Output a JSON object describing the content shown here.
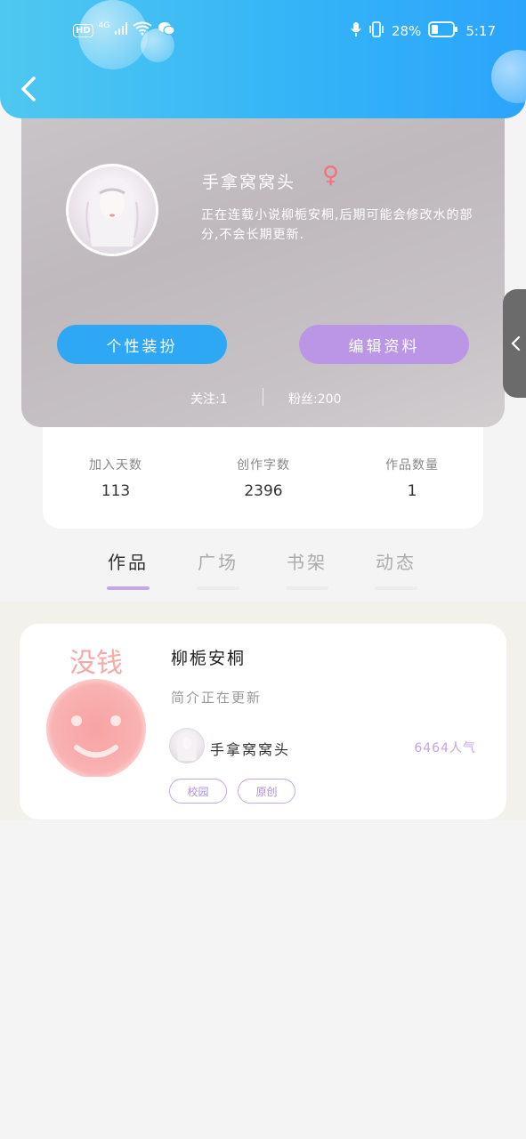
{
  "status_bar": {
    "left_badges": [
      "HD",
      "4G"
    ],
    "battery": "28%",
    "time": "5:17"
  },
  "profile": {
    "username": "手拿窝窝头",
    "gender_symbol": "♀",
    "bio": "正在连载小说柳栀安桐,后期可能会修改水的部分,不会长期更新.",
    "dress_button": "个性装扮",
    "edit_button": "编辑资料",
    "following": "关注:1",
    "followers": "粉丝:200"
  },
  "stats": [
    {
      "label": "加入天数",
      "value": "113"
    },
    {
      "label": "创作字数",
      "value": "2396"
    },
    {
      "label": "作品数量",
      "value": "1"
    }
  ],
  "tabs": [
    {
      "label": "作品",
      "active": true
    },
    {
      "label": "广场",
      "active": false
    },
    {
      "label": "书架",
      "active": false
    },
    {
      "label": "动态",
      "active": false
    }
  ],
  "works": [
    {
      "title": "柳栀安桐",
      "description": "简介正在更新",
      "cover_text": "没钱",
      "author": "手拿窝窝头",
      "popularity": "6464人气",
      "tags": [
        "校园",
        "原创"
      ]
    }
  ],
  "colors": {
    "header": "#35b5f7",
    "accent_blue": "#2ea8f5",
    "accent_purple": "#bb96e6",
    "gender_pink": "#f0727c"
  }
}
